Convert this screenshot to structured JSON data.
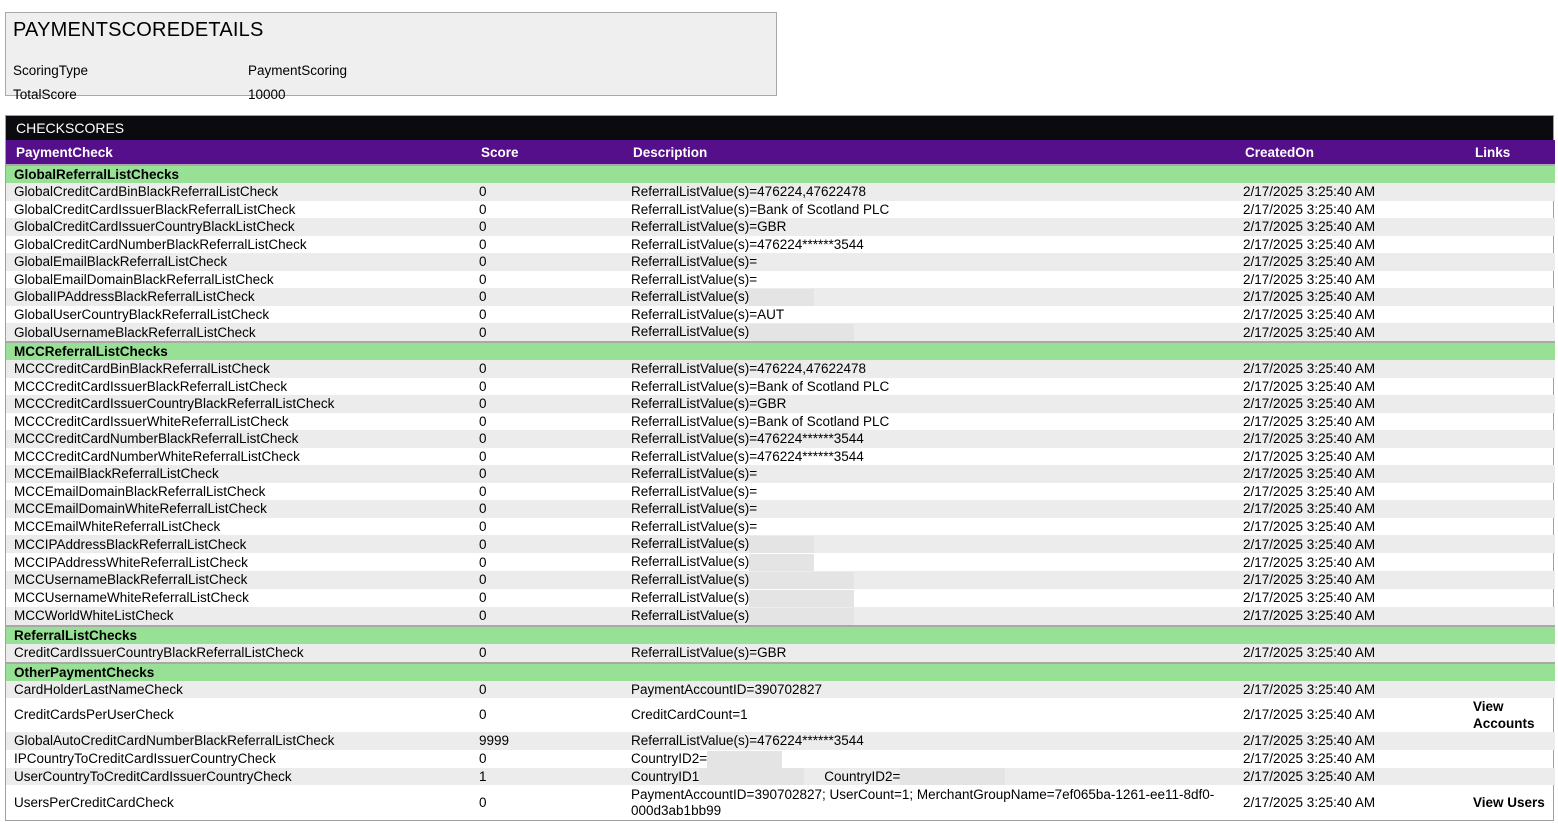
{
  "details": {
    "title": "PAYMENTSCOREDETAILS",
    "rows": [
      {
        "label": "ScoringType",
        "value": "PaymentScoring"
      },
      {
        "label": "TotalScore",
        "value": "10000"
      }
    ]
  },
  "checks": {
    "caption": "CHECKSCORES",
    "headers": [
      "PaymentCheck",
      "Score",
      "Description",
      "CreatedOn",
      "Links"
    ],
    "created": "2/17/2025 3:25:40 AM",
    "groups": [
      {
        "name": "GlobalReferralListChecks",
        "rows": [
          {
            "check": "GlobalCreditCardBinBlackReferralListCheck",
            "score": "0",
            "desc": "ReferralListValue(s)=476224,47622478"
          },
          {
            "check": "GlobalCreditCardIssuerBlackReferralListCheck",
            "score": "0",
            "desc": "ReferralListValue(s)=Bank of Scotland PLC"
          },
          {
            "check": "GlobalCreditCardIssuerCountryBlackListCheck",
            "score": "0",
            "desc": "ReferralListValue(s)=GBR"
          },
          {
            "check": "GlobalCreditCardNumberBlackReferralListCheck",
            "score": "0",
            "desc": "ReferralListValue(s)=476224******3544"
          },
          {
            "check": "GlobalEmailBlackReferralListCheck",
            "score": "0",
            "desc": "ReferralListValue(s)="
          },
          {
            "check": "GlobalEmailDomainBlackReferralListCheck",
            "score": "0",
            "desc": "ReferralListValue(s)="
          },
          {
            "check": "GlobalIPAddressBlackReferralListCheck",
            "score": "0",
            "desc": "ReferralListValue(s)",
            "redact": 65
          },
          {
            "check": "GlobalUserCountryBlackReferralListCheck",
            "score": "0",
            "desc": "ReferralListValue(s)=AUT"
          },
          {
            "check": "GlobalUsernameBlackReferralListCheck",
            "score": "0",
            "desc": "ReferralListValue(s)",
            "redact": 105
          }
        ]
      },
      {
        "name": "MCCReferralListChecks",
        "rows": [
          {
            "check": "MCCCreditCardBinBlackReferralListCheck",
            "score": "0",
            "desc": "ReferralListValue(s)=476224,47622478"
          },
          {
            "check": "MCCCreditCardIssuerBlackReferralListCheck",
            "score": "0",
            "desc": "ReferralListValue(s)=Bank of Scotland PLC"
          },
          {
            "check": "MCCCreditCardIssuerCountryBlackReferralListCheck",
            "score": "0",
            "desc": "ReferralListValue(s)=GBR"
          },
          {
            "check": "MCCCreditCardIssuerWhiteReferralListCheck",
            "score": "0",
            "desc": "ReferralListValue(s)=Bank of Scotland PLC"
          },
          {
            "check": "MCCCreditCardNumberBlackReferralListCheck",
            "score": "0",
            "desc": "ReferralListValue(s)=476224******3544"
          },
          {
            "check": "MCCCreditCardNumberWhiteReferralListCheck",
            "score": "0",
            "desc": "ReferralListValue(s)=476224******3544"
          },
          {
            "check": "MCCEmailBlackReferralListCheck",
            "score": "0",
            "desc": "ReferralListValue(s)="
          },
          {
            "check": "MCCEmailDomainBlackReferralListCheck",
            "score": "0",
            "desc": "ReferralListValue(s)="
          },
          {
            "check": "MCCEmailDomainWhiteReferralListCheck",
            "score": "0",
            "desc": "ReferralListValue(s)="
          },
          {
            "check": "MCCEmailWhiteReferralListCheck",
            "score": "0",
            "desc": "ReferralListValue(s)="
          },
          {
            "check": "MCCIPAddressBlackReferralListCheck",
            "score": "0",
            "desc": "ReferralListValue(s)",
            "redact": 65
          },
          {
            "check": "MCCIPAddressWhiteReferralListCheck",
            "score": "0",
            "desc": "ReferralListValue(s)",
            "redact": 65
          },
          {
            "check": "MCCUsernameBlackReferralListCheck",
            "score": "0",
            "desc": "ReferralListValue(s)",
            "redact": 105
          },
          {
            "check": "MCCUsernameWhiteReferralListCheck",
            "score": "0",
            "desc": "ReferralListValue(s)",
            "redact": 105
          },
          {
            "check": "MCCWorldWhiteListCheck",
            "score": "0",
            "desc": "ReferralListValue(s)",
            "redact": 105
          }
        ]
      },
      {
        "name": "ReferralListChecks",
        "rows": [
          {
            "check": "CreditCardIssuerCountryBlackReferralListCheck",
            "score": "0",
            "desc": "ReferralListValue(s)=GBR"
          }
        ]
      },
      {
        "name": "OtherPaymentChecks",
        "rows": [
          {
            "check": "CardHolderLastNameCheck",
            "score": "0",
            "desc": "PaymentAccountID=390702827"
          },
          {
            "check": "CreditCardsPerUserCheck",
            "score": "0",
            "desc": "CreditCardCount=1",
            "link": "View Accounts",
            "tall": true
          },
          {
            "check": "GlobalAutoCreditCardNumberBlackReferralListCheck",
            "score": "9999",
            "desc": "ReferralListValue(s)=476224******3544"
          },
          {
            "check": "IPCountryToCreditCardIssuerCountryCheck",
            "score": "0",
            "desc": "CountryID2=",
            "redact": 75
          },
          {
            "check": "UserCountryToCreditCardIssuerCountryCheck",
            "score": "1",
            "desc": "CountryID1",
            "redact": 105,
            "desc2": "CountryID2=",
            "redact2": 105
          },
          {
            "check": "UsersPerCreditCardCheck",
            "score": "0",
            "desc": "PaymentAccountID=390702827; UserCount=1; MerchantGroupName=7ef065ba-1261-ee11-8df0-000d3ab1bb99",
            "link": "View Users",
            "tall": true,
            "wrap": true
          }
        ]
      }
    ]
  }
}
